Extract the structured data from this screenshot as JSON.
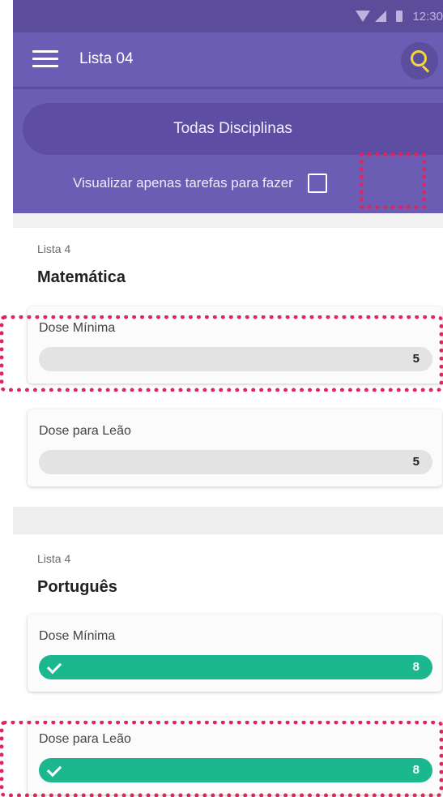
{
  "status_bar": {
    "time": "12:30",
    "icons": [
      "wifi-icon",
      "signal-icon",
      "battery-icon"
    ]
  },
  "app_bar": {
    "title": "Lista 04",
    "menu_icon": "menu-icon",
    "search_icon": "search-icon"
  },
  "filter": {
    "discipline_select": "Todas Disciplinas",
    "only_todo_label": "Visualizar apenas tarefas para fazer",
    "only_todo_checked": false
  },
  "sections": [
    {
      "list_label": "Lista 4",
      "subject": "Matemática",
      "cards": [
        {
          "label": "Dose Mínima",
          "count": "5",
          "done": false
        },
        {
          "label": "Dose para Leão",
          "count": "5",
          "done": false
        }
      ]
    },
    {
      "list_label": "Lista 4",
      "subject": "Português",
      "cards": [
        {
          "label": "Dose Mínima",
          "count": "8",
          "done": true
        },
        {
          "label": "Dose para Leão",
          "count": "8",
          "done": true
        }
      ]
    }
  ],
  "colors": {
    "primary": "#6b5db4",
    "primary_dark": "#5b4d99",
    "accent_search": "#f3d73c",
    "progress_done": "#1bb88f",
    "progress_todo": "#e3e3e3",
    "highlight": "#e0245e"
  }
}
